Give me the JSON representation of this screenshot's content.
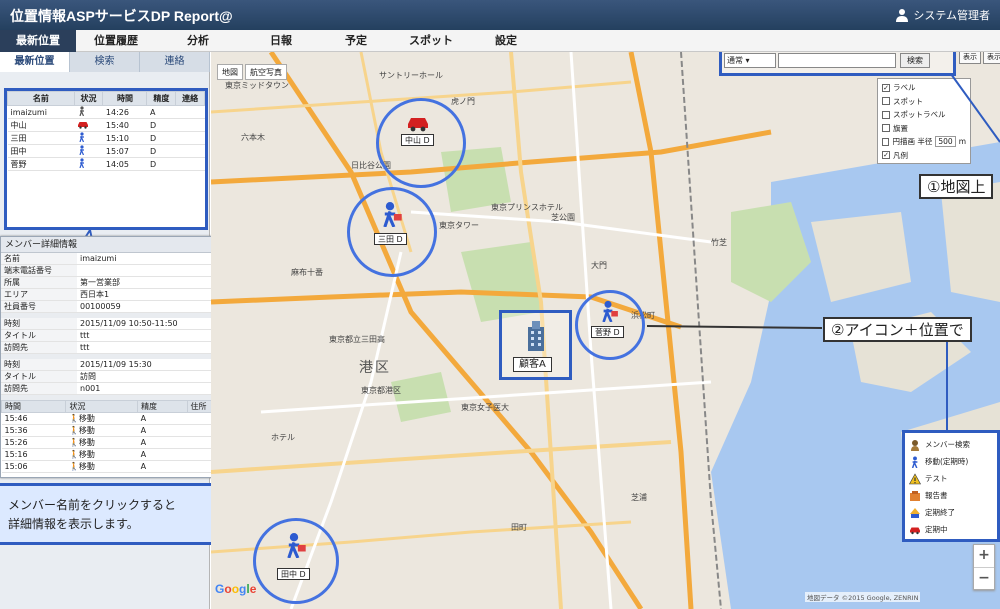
{
  "app": {
    "title": "位置情報ASPサービスDP Report@",
    "user": "システム管理者"
  },
  "menu": [
    {
      "label": "最新位置",
      "active": true
    },
    {
      "label": "位置履歴"
    },
    {
      "label": "分析"
    },
    {
      "label": "日報"
    },
    {
      "label": "予定"
    },
    {
      "label": "スポット"
    },
    {
      "label": "設定"
    }
  ],
  "subtabs": [
    "最新位置",
    "検索",
    "連絡"
  ],
  "member_table": {
    "headers": [
      "名前",
      "状況",
      "時間",
      "精度",
      "連絡"
    ],
    "rows": [
      {
        "name": "imaizumi",
        "status_icon": "walking-person-icon",
        "time": "14:26",
        "acc": "A",
        "contact": ""
      },
      {
        "name": "中山",
        "status_icon": "car-icon",
        "time": "15:40",
        "acc": "D",
        "contact": ""
      },
      {
        "name": "三田",
        "status_icon": "walking-person-icon",
        "time": "15:10",
        "acc": "D",
        "contact": ""
      },
      {
        "name": "田中",
        "status_icon": "walking-person-icon",
        "time": "15:07",
        "acc": "D",
        "contact": ""
      },
      {
        "name": "菅野",
        "status_icon": "walking-person-icon",
        "time": "14:05",
        "acc": "D",
        "contact": ""
      }
    ]
  },
  "detail": {
    "title": "メンバー詳細情報",
    "close": "×",
    "info": [
      {
        "k": "名前",
        "v": "imaizumi"
      },
      {
        "k": "端末電話番号",
        "v": ""
      },
      {
        "k": "所属",
        "v": "第一営業部"
      },
      {
        "k": "エリア",
        "v": "西日本1"
      },
      {
        "k": "社員番号",
        "v": "00100059"
      }
    ],
    "schedule1": [
      {
        "k": "時刻",
        "v": "2015/11/09 10:50-11:50"
      },
      {
        "k": "タイトル",
        "v": "ttt"
      },
      {
        "k": "訪問先",
        "v": "ttt"
      }
    ],
    "schedule2": [
      {
        "k": "時刻",
        "v": "2015/11/09 15:30"
      },
      {
        "k": "タイトル",
        "v": "訪問"
      },
      {
        "k": "訪問先",
        "v": "n001"
      }
    ],
    "history_headers": [
      "時間",
      "状況",
      "精度",
      "住所"
    ],
    "history": [
      {
        "t": "15:46",
        "s": "移動",
        "a": "A",
        "addr": ""
      },
      {
        "t": "15:36",
        "s": "移動",
        "a": "A",
        "addr": ""
      },
      {
        "t": "15:26",
        "s": "移動",
        "a": "A",
        "addr": ""
      },
      {
        "t": "15:16",
        "s": "移動",
        "a": "A",
        "addr": ""
      },
      {
        "t": "15:06",
        "s": "移動",
        "a": "A",
        "addr": ""
      }
    ]
  },
  "note": {
    "line1": "メンバー名前をクリックすると",
    "line2": "詳細情報を表示します。"
  },
  "map": {
    "type_buttons": [
      "地図",
      "航空写真"
    ],
    "search_select": "通常",
    "search_value": "",
    "search_button": "検索",
    "small_buttons": [
      "表示",
      "表示"
    ],
    "options": [
      {
        "label": "ラベル",
        "checked": true
      },
      {
        "label": "スポット",
        "checked": false
      },
      {
        "label": "スポットラベル",
        "checked": false
      },
      {
        "label": "旗置",
        "checked": false
      },
      {
        "label": "円描画 半径",
        "checked": false,
        "radius": "500",
        "unit": "m"
      },
      {
        "label": "凡例",
        "checked": true
      }
    ],
    "callout1": "①地図上",
    "callout2": "②アイコン＋位置で",
    "customer": "顧客A",
    "members": [
      {
        "name": "中山 D",
        "icon": "car-icon"
      },
      {
        "name": "三田 D",
        "icon": "walking-person-icon"
      },
      {
        "name": "菅野 D",
        "icon": "walking-person-icon"
      },
      {
        "name": "田中 D",
        "icon": "walking-person-icon"
      }
    ],
    "labels": {
      "minato": "港区",
      "l1": "サントリーホール",
      "l2": "虎ノ門",
      "l3": "東京タワー",
      "l4": "東京プリンスホテル",
      "l5": "浜松町",
      "l6": "大門",
      "l7": "芝公園",
      "l8": "麻布十番",
      "l9": "東京都立三田高",
      "l10": "芝浦",
      "l11": "田町",
      "l12": "東京ミッドタウン",
      "l13": "六本木",
      "l14": "日比谷公園",
      "l15": "竹芝",
      "l16": "東京都港区",
      "l17": "ホテル",
      "l18": "東京女子医大"
    },
    "legend": [
      {
        "label": "メンバー検索",
        "icon": "member-search-icon"
      },
      {
        "label": "移動(定期時)",
        "icon": "walking-person-icon"
      },
      {
        "label": "テスト",
        "icon": "warning-icon"
      },
      {
        "label": "報告書",
        "icon": "report-icon"
      },
      {
        "label": "定期終了",
        "icon": "end-icon"
      },
      {
        "label": "定期中",
        "icon": "car-icon"
      }
    ],
    "zoom_in": "+",
    "zoom_out": "−",
    "google": "Google",
    "attribution": "地図データ ©2015 Google, ZENRIN"
  }
}
